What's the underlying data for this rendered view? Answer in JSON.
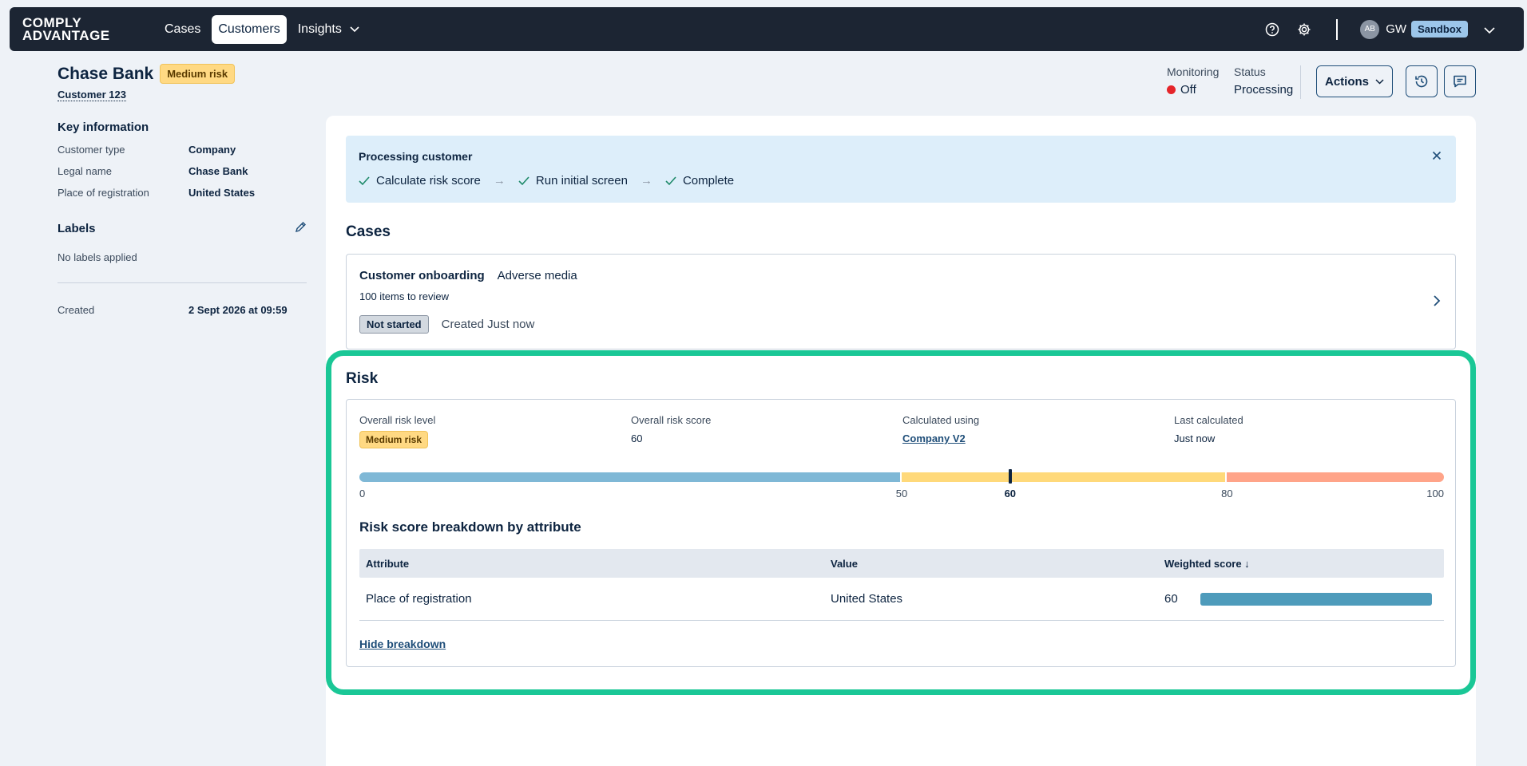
{
  "nav": {
    "logo_line1": "COMPLY",
    "logo_line2": "ADVANTAGE",
    "items": [
      {
        "label": "Cases"
      },
      {
        "label": "Customers",
        "active": true
      },
      {
        "label": "Insights"
      }
    ],
    "avatar": "AB",
    "user_initials": "GW",
    "environment": "Sandbox"
  },
  "customer": {
    "name": "Chase Bank",
    "risk_badge": "Medium risk",
    "id": "Customer 123"
  },
  "key_information": {
    "title": "Key information",
    "rows": [
      {
        "k": "Customer type",
        "v": "Company"
      },
      {
        "k": "Legal name",
        "v": "Chase Bank"
      },
      {
        "k": "Place of registration",
        "v": "United States"
      }
    ]
  },
  "labels": {
    "title": "Labels",
    "empty": "No labels applied"
  },
  "created": {
    "k": "Created",
    "v": "2 Sept 2026 at 09:59"
  },
  "header": {
    "monitoring_label": "Monitoring",
    "monitoring_value": "Off",
    "status_label": "Status",
    "status_value": "Processing",
    "actions_label": "Actions"
  },
  "banner": {
    "title": "Processing customer",
    "steps": [
      "Calculate risk score",
      "Run initial screen",
      "Complete"
    ]
  },
  "cases": {
    "title": "Cases",
    "card": {
      "type": "Customer onboarding",
      "subtype": "Adverse media",
      "items": "100 items to review",
      "status": "Not started",
      "created": "Created Just now"
    }
  },
  "risk": {
    "title": "Risk",
    "overall_level_label": "Overall risk level",
    "overall_level": "Medium risk",
    "overall_score_label": "Overall risk score",
    "overall_score": "60",
    "calculated_using_label": "Calculated using",
    "calculated_using": "Company V2",
    "last_calculated_label": "Last calculated",
    "last_calculated": "Just now",
    "gauge": {
      "min": 0,
      "max": 100,
      "score": 60,
      "bands": [
        {
          "from": 0,
          "to": 50,
          "color": "#7fb8d6"
        },
        {
          "from": 50,
          "to": 80,
          "color": "#ffd97a"
        },
        {
          "from": 80,
          "to": 100,
          "color": "#ffa489"
        }
      ],
      "ticks": [
        "0",
        "50",
        "60",
        "80",
        "100"
      ]
    },
    "breakdown": {
      "title": "Risk score breakdown by attribute",
      "headers": [
        "Attribute",
        "Value",
        "Weighted score ↓"
      ],
      "rows": [
        {
          "attribute": "Place of registration",
          "value": "United States",
          "score": "60",
          "fraction": 1.0
        }
      ],
      "hide_label": "Hide breakdown"
    }
  }
}
